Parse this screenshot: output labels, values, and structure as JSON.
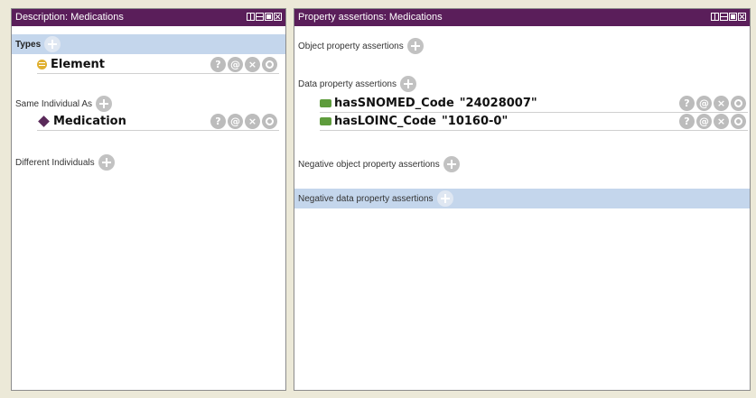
{
  "left_panel": {
    "title": "Description: Medications",
    "sections": {
      "types": {
        "label": "Types"
      },
      "same_individual": {
        "label": "Same Individual As"
      },
      "different_individuals": {
        "label": "Different Individuals"
      }
    },
    "types_items": [
      {
        "label": "Element"
      }
    ],
    "same_items": [
      {
        "label": "Medication"
      }
    ]
  },
  "right_panel": {
    "title": "Property assertions: Medications",
    "sections": {
      "object_props": {
        "label": "Object property assertions"
      },
      "data_props": {
        "label": "Data property assertions"
      },
      "neg_object_props": {
        "label": "Negative object property assertions"
      },
      "neg_data_props": {
        "label": "Negative data property assertions"
      }
    },
    "data_items": [
      {
        "property": "hasSNOMED_Code",
        "value": "\"24028007\""
      },
      {
        "property": "hasLOINC_Code",
        "value": "\"10160-0\""
      }
    ]
  },
  "actions": {
    "help": "?",
    "annotate": "@",
    "delete": "×"
  },
  "icons": {
    "class": "class-icon",
    "individual": "individual-icon",
    "data_property": "data-property-icon",
    "add": "add-icon"
  },
  "colors": {
    "titlebar": "#5a1e5a",
    "section_highlight": "#c4d6ec",
    "action_button": "#bcbcbc",
    "class_icon": "#e0b030",
    "individual_icon": "#5a2a5a",
    "data_property_icon": "#5e9c3c"
  }
}
